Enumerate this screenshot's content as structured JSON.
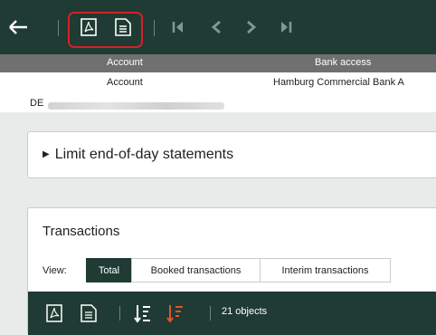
{
  "toolbar": {
    "icons": [
      "back-arrow-icon",
      "pdf-icon",
      "document-icon",
      "first-page-icon",
      "previous-icon",
      "next-icon",
      "last-page-icon"
    ]
  },
  "table_header": {
    "col1": "Account",
    "col2": "Bank access"
  },
  "account_row": {
    "account_label": "Account",
    "bank_access": "Hamburg Commercial Bank A",
    "iban_prefix": "DE"
  },
  "limit_section": {
    "label": "Limit end-of-day statements"
  },
  "transactions": {
    "title": "Transactions",
    "view_label": "View:",
    "tabs": [
      "Total",
      "Booked transactions",
      "Interim transactions"
    ],
    "active_tab": "Total",
    "objects_count": "21 objects"
  },
  "colors": {
    "toolbar": "#1f3b33",
    "highlight": "#d81f2a",
    "sort_accent": "#e0552a"
  }
}
